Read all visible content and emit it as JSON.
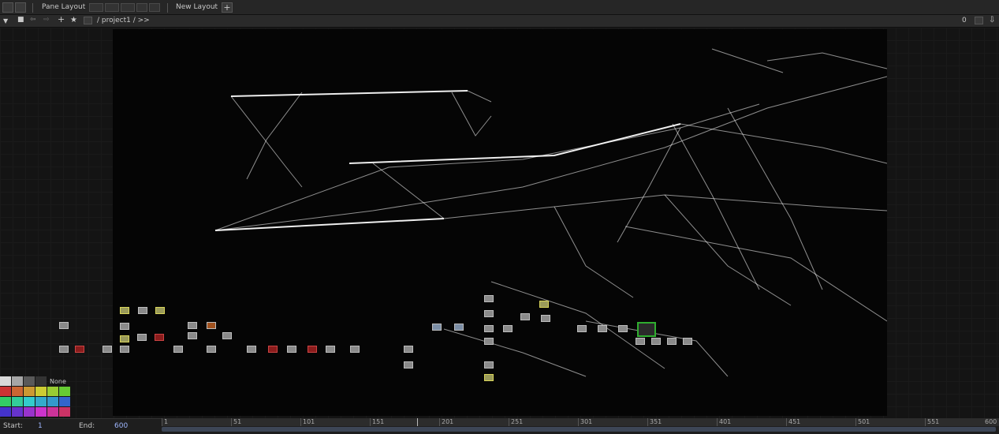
{
  "toolbar": {
    "pane_layout_label": "Pane Layout",
    "new_layout_label": "New Layout",
    "add_label": "+"
  },
  "pathbar": {
    "path": "/ project1 / >>",
    "counter": "0"
  },
  "palette": {
    "none_label": "None",
    "colors": [
      "#d9d9d9",
      "#a6a6a6",
      "#595959",
      "#333333",
      "#cc3333",
      "#cc6633",
      "#cc9933",
      "#cccc33",
      "#99cc33",
      "#66cc33",
      "#33cc66",
      "#33cc99",
      "#33cccc",
      "#3399cc",
      "#3366cc",
      "#3333cc",
      "#6633cc",
      "#9933cc",
      "#cc33cc",
      "#cc3399",
      "#cc3366",
      "#cc3333"
    ]
  },
  "timeline": {
    "start_label": "Start:",
    "start_value": "1",
    "end_label": "End:",
    "end_value": "600",
    "ticks": [
      "1",
      "51",
      "101",
      "151",
      "201",
      "251",
      "301",
      "351",
      "401",
      "451",
      "501",
      "551",
      "600"
    ]
  }
}
